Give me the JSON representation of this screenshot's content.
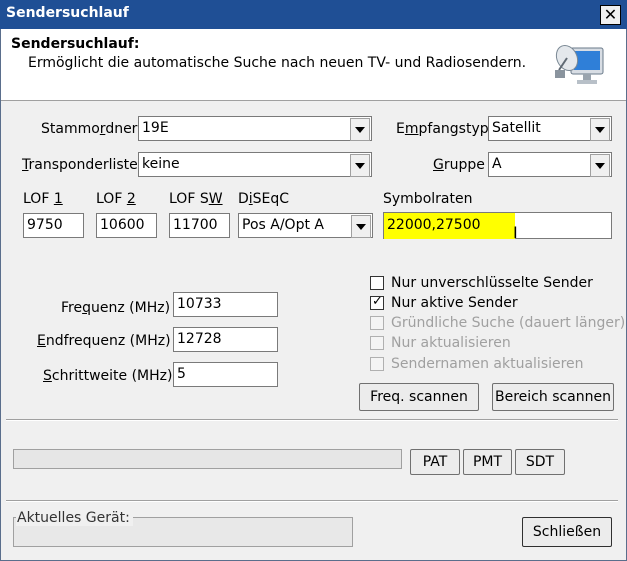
{
  "window": {
    "title": "Sendersuchlauf",
    "close_glyph": "✕"
  },
  "header": {
    "title": "Sendersuchlauf:",
    "description": "Ermöglicht die automatische Suche nach neuen TV- und Radiosendern.",
    "icon": "satellite-dish-monitor-icon"
  },
  "form": {
    "stammordner": {
      "label_pre": "Stammo",
      "label_acc": "r",
      "label_post": "dner",
      "value": "19E"
    },
    "empfangstyp": {
      "label_pre": "E",
      "label_acc": "m",
      "label_post": "pfangstyp",
      "value": "Satellit"
    },
    "transponderliste": {
      "label_pre": "",
      "label_acc": "T",
      "label_post": "ransponderliste",
      "value": "keine"
    },
    "gruppe": {
      "label_pre": "",
      "label_acc": "G",
      "label_post": "ruppe",
      "value": "A"
    },
    "lof1": {
      "label_pre": "LOF ",
      "label_acc": "1",
      "label_post": "",
      "value": "9750"
    },
    "lof2": {
      "label_pre": "LOF ",
      "label_acc": "2",
      "label_post": "",
      "value": "10600"
    },
    "lofsw": {
      "label_pre": "LOF S",
      "label_acc": "W",
      "label_post": "",
      "value": "11700"
    },
    "diseqc": {
      "label_pre": "D",
      "label_acc": "i",
      "label_post": "SEqC",
      "value": "Pos A/Opt A"
    },
    "symbolraten": {
      "label": "Symbolraten",
      "value": "22000,27500",
      "highlight_color": "#ffff00"
    },
    "frequenz": {
      "label_pre": "Fre",
      "label_acc": "q",
      "label_post": "uenz (MHz)",
      "value": "10733"
    },
    "endfrequenz": {
      "label_pre": "",
      "label_acc": "E",
      "label_post": "ndfrequenz (MHz)",
      "value": "12728"
    },
    "schrittweite": {
      "label_pre": "",
      "label_acc": "S",
      "label_post": "chrittweite (MHz)",
      "value": "5"
    }
  },
  "options": [
    {
      "label": "Nur unverschlüsselte Sender",
      "checked": false,
      "enabled": true
    },
    {
      "label": "Nur aktive Sender",
      "checked": true,
      "enabled": true
    },
    {
      "label": "Gründliche Suche (dauert länger)",
      "checked": false,
      "enabled": false
    },
    {
      "label": "Nur aktualisieren",
      "checked": false,
      "enabled": false
    },
    {
      "label": "Sendernamen aktualisieren",
      "checked": false,
      "enabled": false
    }
  ],
  "buttons": {
    "freq_scan": "Freq. scannen",
    "range_scan": "Bereich scannen",
    "pat": "PAT",
    "pmt": "PMT",
    "sdt": "SDT",
    "close": "Schließen"
  },
  "progress": {
    "fraction": 0
  },
  "device_group": {
    "label": "Aktuelles Gerät:",
    "value": ""
  }
}
